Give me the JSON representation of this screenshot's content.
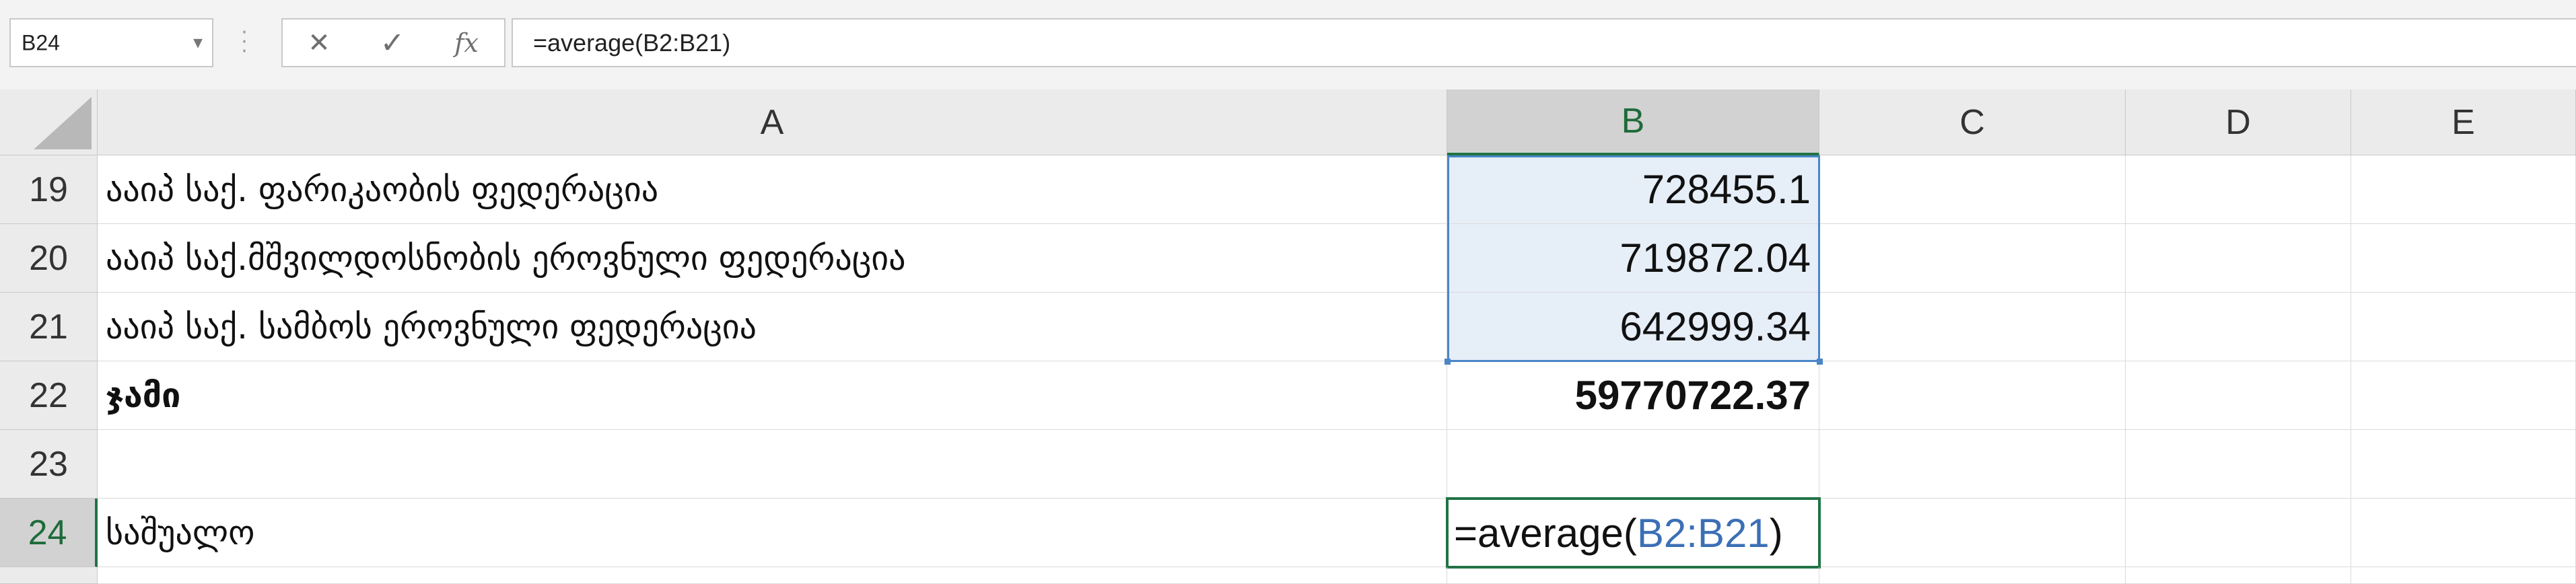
{
  "name_box": {
    "value": "B24"
  },
  "formula_bar": {
    "cancel_glyph": "✕",
    "enter_glyph": "✓",
    "fx_glyph": "fx",
    "formula": "=average(B2:B21)"
  },
  "columns": [
    "A",
    "B",
    "C",
    "D",
    "E"
  ],
  "rows": [
    {
      "num": "19",
      "a": "ააიპ საქ. ფარიკაობის ფედერაცია",
      "b": "728455.1"
    },
    {
      "num": "20",
      "a": "ააიპ  საქ.მშვილდოსნობის ეროვნული ფედერაცია",
      "b": "719872.04"
    },
    {
      "num": "21",
      "a": "ააიპ   საქ. სამბოს ეროვნული ფედერაცია",
      "b": "642999.34"
    },
    {
      "num": "22",
      "a": "ჯამი",
      "b": "59770722.37"
    },
    {
      "num": "23",
      "a": "",
      "b": ""
    },
    {
      "num": "24",
      "a": "საშუალო",
      "b": ""
    }
  ],
  "edit_cell": {
    "prefix": "=average(",
    "ref": "B2:B21",
    "suffix": ")"
  },
  "colors": {
    "accent_green": "#217346",
    "range_blue": "#4a86c8",
    "ref_blue": "#3b6fb6"
  }
}
